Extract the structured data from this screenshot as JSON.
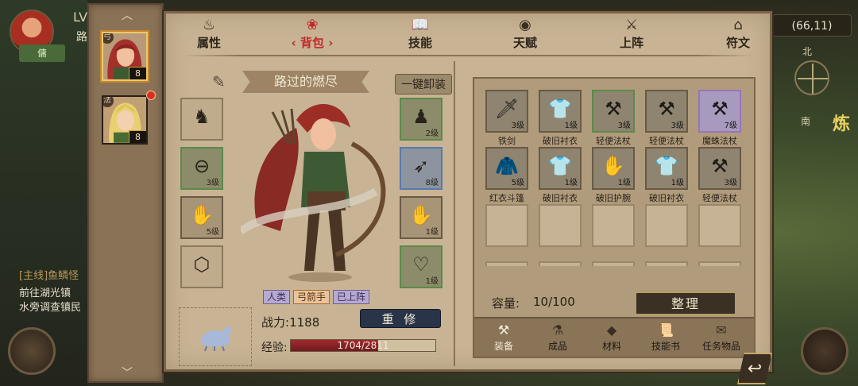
{
  "world": {
    "level_prefix": "LV",
    "road_char": "路",
    "world_button": "傭",
    "coords": "(66,11)",
    "compass_north": "北",
    "compass_south": "南",
    "side_glyph": "炼",
    "quest_title": "[主线]鱼鳞怪",
    "quest_line1": "前往湖光镇",
    "quest_line2": "水旁调查镇民"
  },
  "hero_strip": {
    "up_arrow": "︿",
    "down_arrow": "﹀",
    "heroes": [
      {
        "level": "8",
        "class_badge": "弓",
        "selected": true
      },
      {
        "level": "8",
        "class_badge": "法",
        "selected": false
      }
    ]
  },
  "tabs": [
    {
      "label": "属性",
      "icon": "♨",
      "active": false
    },
    {
      "label": "背包",
      "icon": "❀",
      "active": true
    },
    {
      "label": "技能",
      "icon": "📖",
      "active": false
    },
    {
      "label": "天赋",
      "icon": "◉",
      "active": false
    },
    {
      "label": "上阵",
      "icon": "⚔",
      "active": false
    },
    {
      "label": "符文",
      "icon": "⌂",
      "active": false
    }
  ],
  "character": {
    "name": "路过的燃尽",
    "unequip_all": "一键卸装",
    "slots_left": [
      {
        "glyph": "♞",
        "level": "",
        "quality": "empty"
      },
      {
        "glyph": "⊖",
        "level": "3级",
        "quality": "green"
      },
      {
        "glyph": "✋",
        "level": "5级",
        "quality": "normal"
      },
      {
        "glyph": "⬡",
        "level": "",
        "quality": "empty"
      }
    ],
    "slots_right": [
      {
        "glyph": "♟",
        "level": "2级",
        "quality": "green"
      },
      {
        "glyph": "➶",
        "level": "8级",
        "quality": "blue"
      },
      {
        "glyph": "✋",
        "level": "1级",
        "quality": "normal"
      },
      {
        "glyph": "♡",
        "level": "1级",
        "quality": "green"
      }
    ],
    "tags": [
      {
        "text": "人类",
        "style": "purple"
      },
      {
        "text": "弓箭手",
        "style": "orange"
      },
      {
        "text": "已上阵",
        "style": "purple"
      }
    ],
    "power_label": "战力:",
    "power_value": "1188",
    "rebuild": "重 修",
    "exp_label": "经验:",
    "exp_current": 1704,
    "exp_max": 2811,
    "exp_text": "1704/2811"
  },
  "bag": {
    "items": [
      {
        "name": "铁剑",
        "glyph": "🗡",
        "level": "3级",
        "quality": "normal"
      },
      {
        "name": "破旧衬衣",
        "glyph": "👕",
        "level": "1级",
        "quality": "normal"
      },
      {
        "name": "轻便法杖",
        "glyph": "⚒",
        "level": "3级",
        "quality": "green"
      },
      {
        "name": "轻便法杖",
        "glyph": "⚒",
        "level": "3级",
        "quality": "normal"
      },
      {
        "name": "魔蛛法杖",
        "glyph": "⚒",
        "level": "7级",
        "quality": "purple"
      },
      {
        "name": "红衣斗篷",
        "glyph": "🧥",
        "level": "5级",
        "quality": "normal"
      },
      {
        "name": "破旧衬衣",
        "glyph": "👕",
        "level": "1级",
        "quality": "normal"
      },
      {
        "name": "破旧护腕",
        "glyph": "✋",
        "level": "1级",
        "quality": "normal"
      },
      {
        "name": "破旧衬衣",
        "glyph": "👕",
        "level": "1级",
        "quality": "normal"
      },
      {
        "name": "轻便法杖",
        "glyph": "⚒",
        "level": "3级",
        "quality": "normal"
      }
    ],
    "capacity_label": "容量:",
    "capacity_value": "10/100",
    "sort_button": "整理",
    "tabs": [
      {
        "label": "装备",
        "icon": "⚒",
        "active": true
      },
      {
        "label": "成品",
        "icon": "⚗",
        "active": false
      },
      {
        "label": "材料",
        "icon": "◆",
        "active": false
      },
      {
        "label": "技能书",
        "icon": "📜",
        "active": false
      },
      {
        "label": "任务物品",
        "icon": "✉",
        "active": false
      }
    ]
  },
  "back_button": "↩"
}
